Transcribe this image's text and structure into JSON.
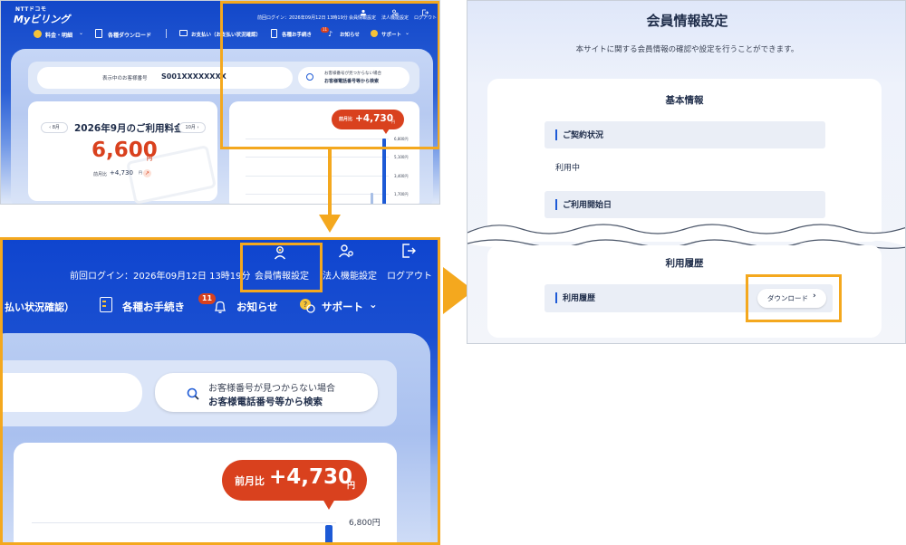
{
  "panel_top": {
    "logo_brand": "NTTドコモ",
    "logo_name": "Myビリング",
    "last_login": "前回ログイン：2026年09月12日 13時19分",
    "nav_member": "会員情報設定",
    "nav_corporate": "法人機能設定",
    "nav_logout": "ログアウト",
    "menu": [
      "料金・明細",
      "各種ダウンロード",
      "お支払い（お支払い状況確認）",
      "各種お手続き",
      "お知らせ",
      "サポート"
    ],
    "notification_count": "11",
    "customer_label": "表示中のお客様番号",
    "customer_number": "S001XXXXXXXX",
    "search_hint_1": "お客様番号が見つからない場合",
    "search_hint_2": "お客様電話番号等から検索",
    "prev_month": "8月",
    "next_month": "10月",
    "usage_title": "2026年9月のご利用料金",
    "usage_amount": "6,600",
    "yen": "円",
    "diff_label": "前月比",
    "diff_value": "+4,730",
    "chart_bubble_label": "前月比",
    "chart_bubble_value": "+4,730",
    "chart_ticks": [
      "6,800円",
      "5,100円",
      "3,400円",
      "1,700円"
    ]
  },
  "panel_zoom": {
    "last_login": "前回ログイン：2026年09月12日 13時19分",
    "nav_member": "会員情報設定",
    "nav_corporate": "法人機能設定",
    "nav_logout": "ログアウト",
    "menu_payment": "払い状況確認）",
    "menu_procedures": "各種お手続き",
    "menu_notice": "お知らせ",
    "menu_support": "サポート",
    "notification_count": "11",
    "search_hint_1": "お客様番号が見つからない場合",
    "search_hint_2": "お客様電話番号等から検索",
    "bubble_label": "前月比",
    "bubble_value": "+4,730",
    "bubble_yen": "円",
    "tick_top": "6,800円"
  },
  "panel_page": {
    "title": "会員情報設定",
    "subtitle": "本サイトに関する会員情報の確認や設定を行うことができます。",
    "section_basic": "基本情報",
    "row_contract": "ご契約状況",
    "contract_value": "利用中",
    "row_start": "ご利用開始日",
    "section_history": "利用履歴",
    "row_history": "利用履歴",
    "download_label": "ダウンロード"
  },
  "colors": {
    "brand_blue": "#1247c9",
    "accent_orange": "#f4a81e",
    "alert_red": "#d9411e"
  }
}
